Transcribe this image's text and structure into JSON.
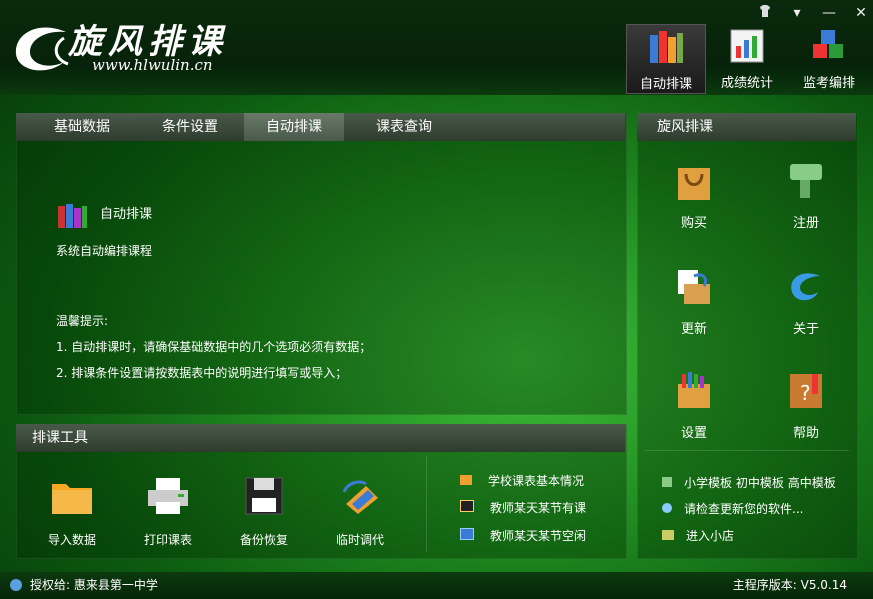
{
  "app": {
    "title": "旋风排课",
    "url": "www.hlwulin.cn"
  },
  "window_controls": {
    "skin": "skin-icon",
    "menu": "▾",
    "minimize": "—",
    "close": "✕"
  },
  "top_nav": [
    {
      "label": "自动排课",
      "icon": "books-icon"
    },
    {
      "label": "成绩统计",
      "icon": "chart-icon"
    },
    {
      "label": "监考编排",
      "icon": "cubes-icon"
    }
  ],
  "tabs": [
    {
      "label": "基础数据"
    },
    {
      "label": "条件设置"
    },
    {
      "label": "自动排课"
    },
    {
      "label": "课表查询"
    }
  ],
  "main": {
    "title": "自动排课",
    "desc": "系统自动编排课程",
    "tips_title": "温馨提示:",
    "tip1": "1. 自动排课时，请确保基础数据中的几个选项必须有数据；",
    "tip2": "2. 排课条件设置请按数据表中的说明进行填写或导入；"
  },
  "tools": {
    "title": "排课工具",
    "items": [
      {
        "label": "导入数据",
        "icon": "folder-icon"
      },
      {
        "label": "打印课表",
        "icon": "printer-icon"
      },
      {
        "label": "备份恢复",
        "icon": "floppy-icon"
      },
      {
        "label": "临时调代",
        "icon": "swap-icon"
      }
    ]
  },
  "queries": [
    {
      "label": "学校课表基本情况"
    },
    {
      "label": "教师某天某节有课"
    },
    {
      "label": "教师某天某节空闲"
    }
  ],
  "sidebar": {
    "title": "旋风排课",
    "items": [
      {
        "label": "购买"
      },
      {
        "label": "注册"
      },
      {
        "label": "更新"
      },
      {
        "label": "关于"
      },
      {
        "label": "设置"
      },
      {
        "label": "帮助"
      }
    ],
    "templates": [
      "小学模板",
      "初中模板",
      "高中模板"
    ],
    "check_update": "请检查更新您的软件...",
    "shop": "进入小店"
  },
  "footer": {
    "license": "授权给: 惠来县第一中学",
    "version": "主程序版本: V5.0.14"
  }
}
